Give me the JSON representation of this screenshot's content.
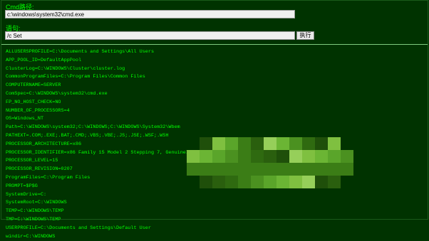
{
  "form": {
    "cmd_path_label": "Cmd路径:",
    "cmd_path_value": "c:\\windows\\system32\\cmd.exe",
    "statement_label": "语句:",
    "statement_value": "/c Set",
    "execute_button": "执行"
  },
  "output": {
    "lines": [
      "ALLUSERSPROFILE=C:\\Documents and Settings\\All Users",
      "APP_POOL_ID=DefaultAppPool",
      "ClusterLog=C:\\WINDOWS\\Cluster\\cluster.log",
      "CommonProgramFiles=C:\\Program Files\\Common Files",
      "COMPUTERNAME=SERVER",
      "ComSpec=C:\\WINDOWS\\system32\\cmd.exe",
      "FP_NO_HOST_CHECK=NO",
      "NUMBER_OF_PROCESSORS=4",
      "OS=Windows_NT",
      "Path=C:\\WINDOWS\\system32;C:\\WINDOWS;C:\\WINDOWS\\System32\\Wbem",
      "PATHEXT=.COM;.EXE;.BAT;.CMD;.VBS;.VBE;.JS;.JSE;.WSF;.WSH",
      "PROCESSOR_ARCHITECTURE=x86",
      "PROCESSOR_IDENTIFIER=x86 Family 15 Model 2 Stepping 7, GenuineIntel",
      "PROCESSOR_LEVEL=15",
      "PROCESSOR_REVISION=0207",
      "ProgramFiles=C:\\Program Files",
      "PROMPT=$P$G",
      "SystemDrive=C:",
      "SystemRoot=C:\\WINDOWS",
      "TEMP=C:\\WINDOWS\\TEMP",
      "TMP=C:\\WINDOWS\\TEMP",
      "USERPROFILE=C:\\Documents and Settings\\Default User",
      "windir=C:\\WINDOWS"
    ]
  },
  "colors": {
    "background": "#003300",
    "text": "#00ff00",
    "divider": "#7fcc7f"
  }
}
